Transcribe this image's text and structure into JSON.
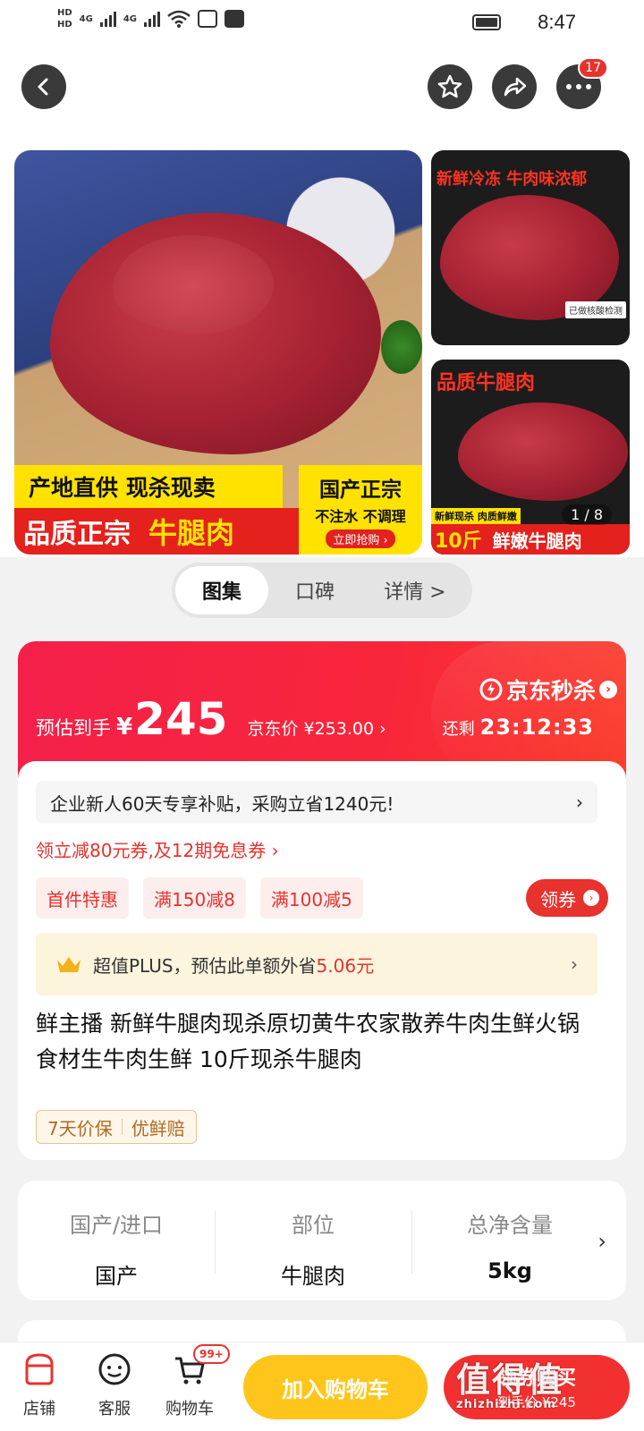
{
  "status_bar": {
    "time": "8:47",
    "hd1": "HD",
    "hd2": "HD",
    "net1": "4G",
    "net2": "4G"
  },
  "nav": {
    "notification_count": "17"
  },
  "gallery": {
    "main_banner_top": "产地直供 现杀现卖",
    "main_banner_left": "品质正宗",
    "main_banner_highlight": "牛腿肉",
    "main_badge_title": "国产正宗",
    "main_badge_sub": "不注水 不调理",
    "main_badge_cta": "立即抢购 ›",
    "side1_title": "新鲜冷冻 牛肉味浓郁",
    "side1_note": "已做核酸检测",
    "side2_title": "品质牛腿肉",
    "side2_strip": "新鲜现杀 肉质鲜嫩",
    "side2_bottom_left": "10斤",
    "side2_bottom_right": "鲜嫩牛腿肉",
    "pager": "1 / 8"
  },
  "tabs": [
    {
      "label": "图集",
      "active": true
    },
    {
      "label": "口碑",
      "active": false
    },
    {
      "label": "详情 >",
      "active": false
    }
  ],
  "price": {
    "label": "预估到手",
    "currency": "¥",
    "amount": "245",
    "jd_price": "京东价 ¥253.00 ›",
    "flash_title": "京东秒杀",
    "remaining_label": "还剩",
    "countdown": "23:12:33"
  },
  "subsidy": {
    "text": "企业新人60天专享补贴，采购立省1240元!",
    "chevron": "›"
  },
  "coupon_line": "领立减80元券,及12期免息券 ›",
  "chips": [
    "首件特惠",
    "满150减8",
    "满100减5"
  ],
  "coupon_button": "领券",
  "plus": {
    "text": "超值PLUS，预估此单额外省",
    "amount": "5.06元",
    "chevron": "›"
  },
  "product_title": "鲜主播 新鲜牛腿肉现杀原切黄牛农家散养牛肉生鲜火锅食材生牛肉生鲜 10斤现杀牛腿肉",
  "tags": [
    "7天价保",
    "优鲜赔"
  ],
  "attributes": [
    {
      "key": "国产/进口",
      "value": "国产"
    },
    {
      "key": "部位",
      "value": "牛腿肉"
    },
    {
      "key": "总净含量",
      "value": "5kg"
    }
  ],
  "bottom_bar": {
    "store": "店铺",
    "service": "客服",
    "cart": "购物车",
    "cart_badge": "99+",
    "add_to_cart": "加入购物车",
    "buy_now": "领券购买",
    "buy_now_sub": "到手价 ¥245"
  },
  "watermark": {
    "main": "值得值",
    "url": "zhizhizhi.com"
  },
  "colors": {
    "accent_red": "#e8322e",
    "cart_yellow": "#ffc51a",
    "flash_red": "#f4204a"
  }
}
